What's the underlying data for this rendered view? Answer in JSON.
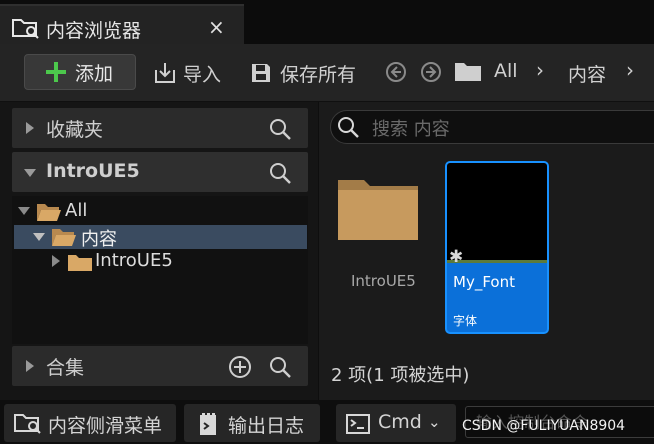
{
  "tab": {
    "title": "内容浏览器",
    "close": "×"
  },
  "toolbar": {
    "add_label": "添加",
    "import_label": "导入",
    "save_all_label": "保存所有",
    "path": [
      "All",
      "内容"
    ]
  },
  "left": {
    "favorites_label": "收藏夹",
    "project_label": "IntroUE5",
    "tree": [
      {
        "label": "All"
      },
      {
        "label": "内容"
      },
      {
        "label": "IntroUE5"
      }
    ],
    "collections_label": "合集"
  },
  "right": {
    "search_placeholder": "搜索 内容",
    "items": [
      {
        "name": "IntroUE5",
        "kind": "folder"
      },
      {
        "name": "My_Font",
        "type": "字体",
        "selected": true
      }
    ],
    "status": "2 项(1 项被选中)"
  },
  "bottom": {
    "drawer_label": "内容侧滑菜单",
    "output_log_label": "输出日志",
    "cmd_label": "Cmd",
    "console_placeholder": "输入控制台命令"
  },
  "watermark": "CSDN @FULIYUAN8904",
  "colors": {
    "accent": "#0b70d9",
    "add_plus": "#4cc84c",
    "folder": "#c79a5e",
    "selected_row": "#3a4b60"
  }
}
